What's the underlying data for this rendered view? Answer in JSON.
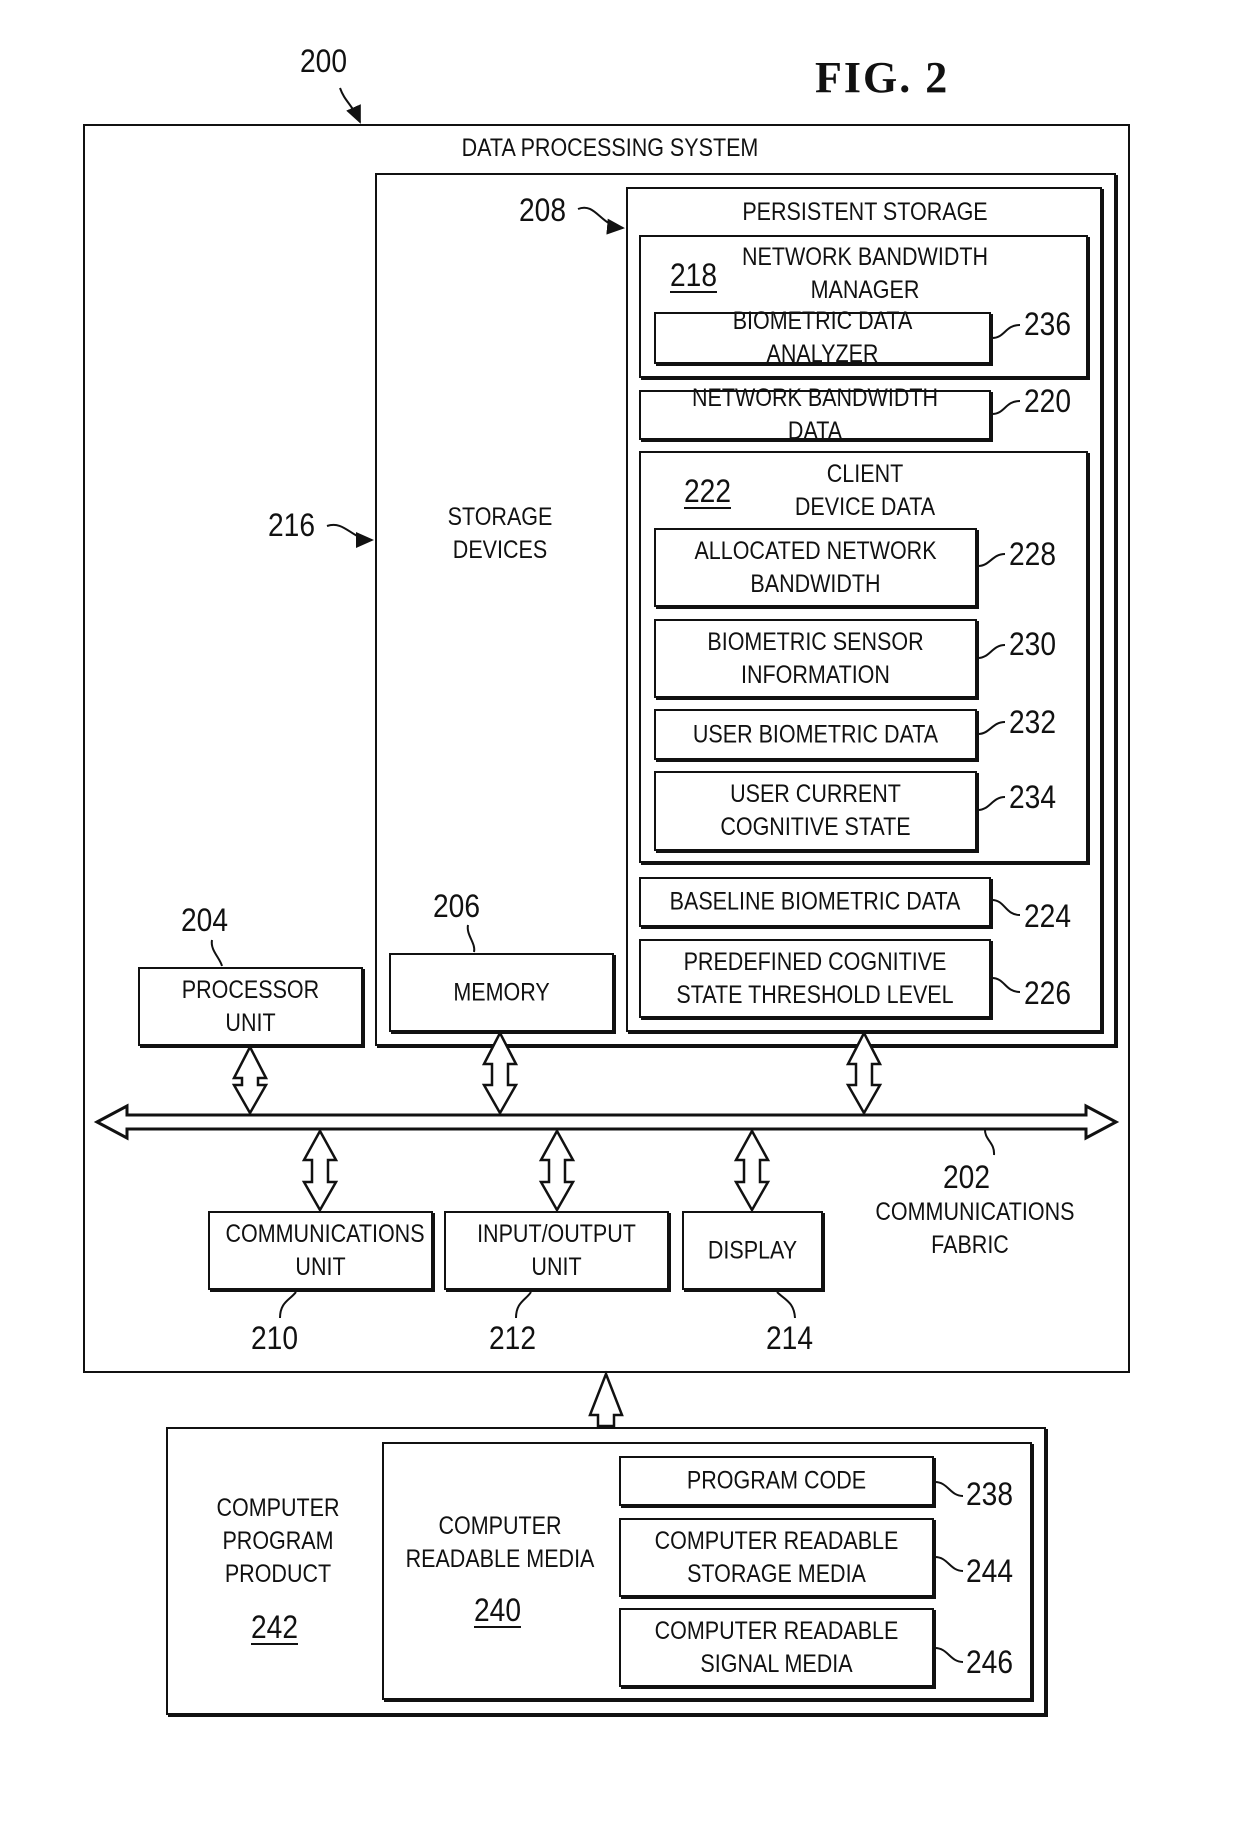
{
  "figure": {
    "title": "FIG. 2",
    "ref_main": "200"
  },
  "data_processing_system": {
    "title": "DATA PROCESSING SYSTEM",
    "storage_devices": {
      "label": "STORAGE\nDEVICES",
      "ref": "216"
    },
    "persistent_storage": {
      "label": "PERSISTENT STORAGE",
      "ref": "208"
    },
    "network_bandwidth_manager": {
      "label": "NETWORK BANDWIDTH\nMANAGER",
      "ref": "218",
      "biometric_data_analyzer": {
        "label": "BIOMETRIC DATA ANALYZER",
        "ref": "236"
      }
    },
    "network_bandwidth_data": {
      "label": "NETWORK BANDWIDTH DATA",
      "ref": "220"
    },
    "client_device_data": {
      "label": "CLIENT\nDEVICE DATA",
      "ref": "222",
      "items": [
        {
          "label": "ALLOCATED NETWORK\nBANDWIDTH",
          "ref": "228"
        },
        {
          "label": "BIOMETRIC SENSOR\nINFORMATION",
          "ref": "230"
        },
        {
          "label": "USER BIOMETRIC DATA",
          "ref": "232"
        },
        {
          "label": "USER CURRENT\nCOGNITIVE STATE",
          "ref": "234"
        }
      ]
    },
    "baseline_biometric_data": {
      "label": "BASELINE BIOMETRIC DATA",
      "ref": "224"
    },
    "predefined_threshold": {
      "label": "PREDEFINED COGNITIVE\nSTATE THRESHOLD LEVEL",
      "ref": "226"
    },
    "processor_unit": {
      "label": "PROCESSOR UNIT",
      "ref": "204"
    },
    "memory": {
      "label": "MEMORY",
      "ref": "206"
    },
    "communications_fabric": {
      "label": "COMMUNICATIONS\nFABRIC",
      "ref": "202"
    },
    "communications_unit": {
      "label": "COMMUNICATIONS\nUNIT",
      "ref": "210"
    },
    "input_output_unit": {
      "label": "INPUT/OUTPUT\nUNIT",
      "ref": "212"
    },
    "display": {
      "label": "DISPLAY",
      "ref": "214"
    }
  },
  "computer_program_product": {
    "label": "COMPUTER\nPROGRAM\nPRODUCT",
    "ref": "242",
    "computer_readable_media": {
      "label": "COMPUTER\nREADABLE MEDIA",
      "ref": "240",
      "items": [
        {
          "label": "PROGRAM CODE",
          "ref": "238"
        },
        {
          "label": "COMPUTER READABLE\nSTORAGE MEDIA",
          "ref": "244"
        },
        {
          "label": "COMPUTER READABLE\nSIGNAL MEDIA",
          "ref": "246"
        }
      ]
    }
  }
}
